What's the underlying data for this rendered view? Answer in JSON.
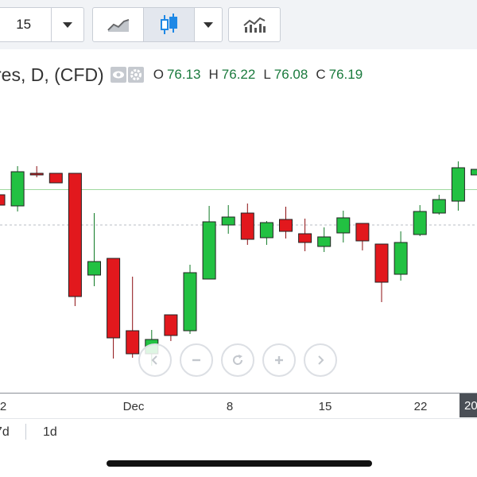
{
  "toolbar": {
    "interval_value": "15",
    "buttons": [
      {
        "name": "line-chart-icon"
      },
      {
        "name": "candlestick-icon",
        "active": true
      },
      {
        "name": "indicators-icon"
      }
    ]
  },
  "legend": {
    "title": "res, D, (CFD)",
    "open_label": "O",
    "open": "76.13",
    "high_label": "H",
    "high": "76.22",
    "low_label": "L",
    "low": "76.08",
    "close_label": "C",
    "close": "76.19"
  },
  "colors": {
    "up": "#22c142",
    "down": "#e2181d",
    "last_price_line": "#9fd89f",
    "dotted_line": "#b9bec5"
  },
  "chart_data": {
    "type": "candlestick",
    "last_price": 76.19,
    "reference_price": 75.3,
    "candles": [
      {
        "o": 76.06,
        "h": 76.1,
        "l": 75.82,
        "c": 75.8
      },
      {
        "o": 75.78,
        "h": 76.78,
        "l": 75.64,
        "c": 76.64
      },
      {
        "o": 76.6,
        "h": 76.78,
        "l": 76.5,
        "c": 76.56
      },
      {
        "o": 76.6,
        "h": 76.6,
        "l": 76.36,
        "c": 76.36
      },
      {
        "o": 76.6,
        "h": 76.6,
        "l": 73.26,
        "c": 73.5
      },
      {
        "o": 74.04,
        "h": 75.6,
        "l": 73.76,
        "c": 74.38
      },
      {
        "o": 74.46,
        "h": 74.46,
        "l": 71.94,
        "c": 72.46
      },
      {
        "o": 72.64,
        "h": 74.0,
        "l": 71.96,
        "c": 72.06
      },
      {
        "o": 72.06,
        "h": 72.66,
        "l": 71.76,
        "c": 72.42
      },
      {
        "o": 73.04,
        "h": 73.04,
        "l": 72.38,
        "c": 72.52
      },
      {
        "o": 72.64,
        "h": 74.3,
        "l": 72.56,
        "c": 74.1
      },
      {
        "o": 73.94,
        "h": 75.78,
        "l": 73.94,
        "c": 75.38
      },
      {
        "o": 75.3,
        "h": 75.8,
        "l": 75.08,
        "c": 75.5
      },
      {
        "o": 75.6,
        "h": 75.84,
        "l": 74.8,
        "c": 74.94
      },
      {
        "o": 74.98,
        "h": 75.4,
        "l": 74.8,
        "c": 75.36
      },
      {
        "o": 75.44,
        "h": 75.76,
        "l": 74.96,
        "c": 75.14
      },
      {
        "o": 75.08,
        "h": 75.46,
        "l": 74.64,
        "c": 74.86
      },
      {
        "o": 74.76,
        "h": 75.24,
        "l": 74.62,
        "c": 75.0
      },
      {
        "o": 75.1,
        "h": 75.66,
        "l": 74.86,
        "c": 75.48
      },
      {
        "o": 75.34,
        "h": 75.34,
        "l": 74.66,
        "c": 74.9
      },
      {
        "o": 74.82,
        "h": 74.82,
        "l": 73.36,
        "c": 73.86
      },
      {
        "o": 74.06,
        "h": 75.14,
        "l": 73.9,
        "c": 74.86
      },
      {
        "o": 75.06,
        "h": 75.8,
        "l": 75.02,
        "c": 75.64
      },
      {
        "o": 75.6,
        "h": 76.06,
        "l": 75.56,
        "c": 75.94
      },
      {
        "o": 75.9,
        "h": 76.9,
        "l": 75.66,
        "c": 76.74
      },
      {
        "o": 76.56,
        "h": 76.78,
        "l": 76.52,
        "c": 76.7
      }
    ],
    "x_ticks": [
      "2",
      "Dec",
      "8",
      "15",
      "22"
    ],
    "x_badge": "20",
    "grid": false
  },
  "ranges": [
    "7d",
    "1d"
  ]
}
